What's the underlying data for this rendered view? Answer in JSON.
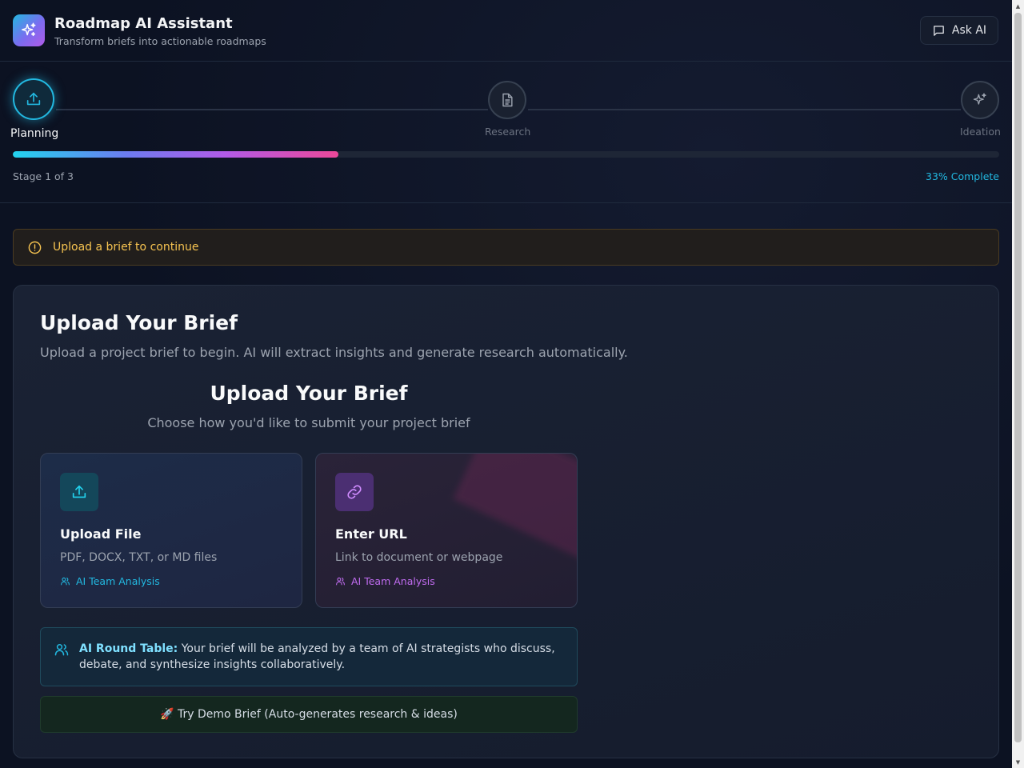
{
  "header": {
    "title": "Roadmap AI Assistant",
    "subtitle": "Transform briefs into actionable roadmaps",
    "ask_label": "Ask AI"
  },
  "stepper": {
    "steps": [
      {
        "label": "Planning",
        "icon": "upload-icon",
        "state": "active"
      },
      {
        "label": "Research",
        "icon": "document-icon",
        "state": "pending"
      },
      {
        "label": "Ideation",
        "icon": "sparkles-icon",
        "state": "pending"
      }
    ],
    "progress_fraction": 0.33,
    "stage_text": "Stage 1 of 3",
    "complete_text": "33% Complete"
  },
  "alert": {
    "icon": "alert-circle-icon",
    "text": "Upload a brief to continue"
  },
  "card": {
    "title": "Upload Your Brief",
    "subtitle": "Upload a project brief to begin. AI will extract insights and generate research automatically.",
    "inner_title": "Upload Your Brief",
    "inner_subtitle": "Choose how you'd like to submit your project brief",
    "options": [
      {
        "title": "Upload File",
        "desc": "PDF, DOCX, TXT, or MD files",
        "tag": "AI Team Analysis",
        "icon": "upload-icon"
      },
      {
        "title": "Enter URL",
        "desc": "Link to document or webpage",
        "tag": "AI Team Analysis",
        "icon": "link-icon"
      }
    ],
    "roundtable": {
      "bold": "AI Round Table:",
      "text": " Your brief will be analyzed by a team of AI strategists who discuss, debate, and synthesize insights collaboratively."
    },
    "demo_label": "🚀 Try Demo Brief (Auto-generates research & ideas)"
  },
  "colors": {
    "accent": "#22b8e0",
    "purple": "#b15be8",
    "warning": "#f6c350",
    "background": "#0c1222"
  }
}
